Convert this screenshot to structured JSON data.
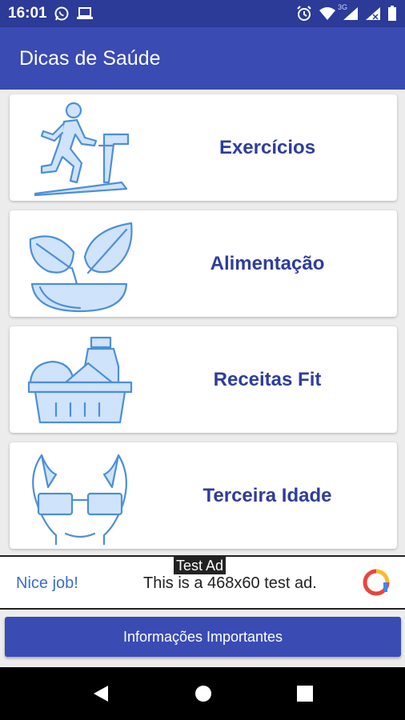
{
  "status_bar": {
    "time": "16:01",
    "network_label": "3G",
    "icons": [
      "whatsapp-icon",
      "laptop-icon",
      "alarm-icon",
      "wifi-icon",
      "signal-icon",
      "signal-icon",
      "battery-icon"
    ]
  },
  "app_bar": {
    "title": "Dicas de Saúde",
    "color": "#3a4bb4"
  },
  "categories": [
    {
      "label": "Exercícios",
      "icon": "treadmill-icon"
    },
    {
      "label": "Alimentação",
      "icon": "plant-bowl-icon"
    },
    {
      "label": "Receitas Fit",
      "icon": "food-basket-icon"
    },
    {
      "label": "Terceira Idade",
      "icon": "elderly-person-icon"
    }
  ],
  "ad": {
    "tag": "Test Ad",
    "headline": "Nice job!",
    "text": "This is a 468x60 test ad.",
    "icon": "ad-logo-icon"
  },
  "footer_button": {
    "label": "Informações Importantes"
  },
  "nav_bar": {
    "back": "back-icon",
    "home": "home-icon",
    "recents": "recents-icon"
  },
  "colors": {
    "accent": "#3a4bb4",
    "status_bar": "#2c3a98",
    "card_label": "#2e3d9c",
    "icon_fill": "#cfe3fb",
    "icon_stroke": "#4d8fd6"
  }
}
